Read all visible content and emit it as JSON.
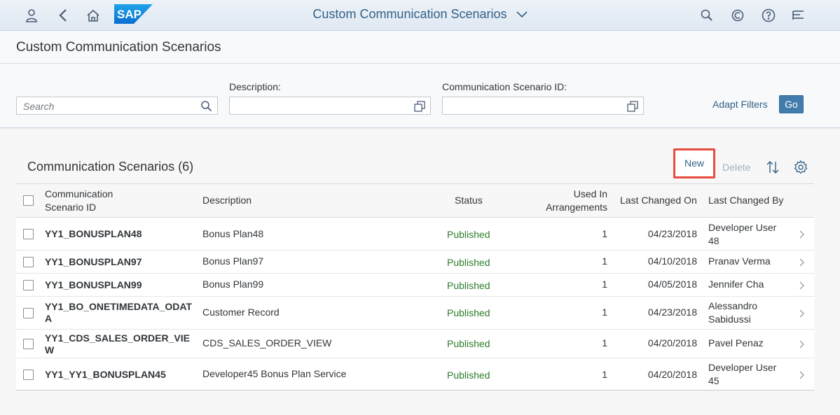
{
  "shell": {
    "title": "Custom Communication Scenarios",
    "icons": [
      "user-icon",
      "back-icon",
      "home-icon",
      "search-icon",
      "copilot-icon",
      "help-icon",
      "notifications-icon"
    ],
    "logo_text": "SAP"
  },
  "page": {
    "title": "Custom Communication Scenarios"
  },
  "filters": {
    "search_placeholder": "Search",
    "description_label": "Description:",
    "scenario_id_label": "Communication Scenario ID:",
    "adapt_filters": "Adapt Filters",
    "go": "Go"
  },
  "table": {
    "title": "Communication Scenarios (6)",
    "new": "New",
    "delete": "Delete",
    "columns": {
      "id_line1": "Communication",
      "id_line2": "Scenario ID",
      "description": "Description",
      "status": "Status",
      "used_line1": "Used In",
      "used_line2": "Arrangements",
      "changed_on": "Last Changed On",
      "changed_by": "Last Changed By"
    },
    "rows": [
      {
        "id": [
          "YY1_BONUSPLAN48"
        ],
        "description": "Bonus Plan48",
        "status": "Published",
        "used": "1",
        "changed_on": "04/23/2018",
        "changed_by": [
          "Developer User",
          "48"
        ]
      },
      {
        "id": [
          "YY1_BONUSPLAN97"
        ],
        "description": "Bonus Plan97",
        "status": "Published",
        "used": "1",
        "changed_on": "04/10/2018",
        "changed_by": [
          "Pranav Verma"
        ]
      },
      {
        "id": [
          "YY1_BONUSPLAN99"
        ],
        "description": "Bonus Plan99",
        "status": "Published",
        "used": "1",
        "changed_on": "04/05/2018",
        "changed_by": [
          "Jennifer Cha"
        ]
      },
      {
        "id": [
          "YY1_BO_ONETIMEDATA_ODAT",
          "A"
        ],
        "description": "Customer Record",
        "status": "Published",
        "used": "1",
        "changed_on": "04/23/2018",
        "changed_by": [
          "Alessandro",
          "Sabidussi"
        ]
      },
      {
        "id": [
          "YY1_CDS_SALES_ORDER_VIE",
          "W"
        ],
        "description": "CDS_SALES_ORDER_VIEW",
        "status": "Published",
        "used": "1",
        "changed_on": "04/20/2018",
        "changed_by": [
          "Pavel Penaz"
        ]
      },
      {
        "id": [
          "YY1_YY1_BONUSPLAN45"
        ],
        "description": "Developer45 Bonus Plan Service",
        "status": "Published",
        "used": "1",
        "changed_on": "04/20/2018",
        "changed_by": [
          "Developer User",
          "45"
        ]
      }
    ]
  },
  "colors": {
    "accent": "#346187",
    "button": "#427cac",
    "status_published": "#2b7d2b",
    "highlight": "#e84c3d"
  }
}
